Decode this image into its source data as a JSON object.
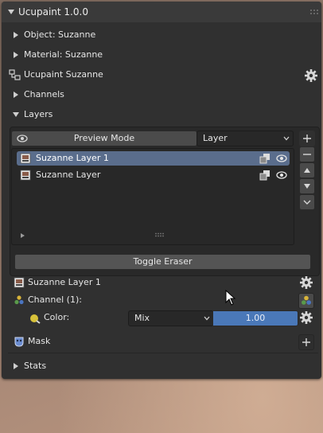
{
  "panel": {
    "title": "Ucupaint 1.0.0",
    "sections": {
      "object": "Object: Suzanne",
      "material": "Material: Suzanne",
      "ucupaint_node": "Ucupaint Suzanne",
      "channels": "Channels",
      "layers": "Layers",
      "stats": "Stats"
    }
  },
  "layers": {
    "preview_mode_label": "Preview Mode",
    "preview_dropdown_value": "Layer",
    "items": [
      {
        "name": "Suzanne Layer 1",
        "selected": true
      },
      {
        "name": "Suzanne Layer",
        "selected": false
      }
    ],
    "toggle_eraser_label": "Toggle Eraser"
  },
  "active_layer": {
    "name": "Suzanne Layer 1",
    "channel_label": "Channel (1):",
    "color_label": "Color:",
    "blend_mode": "Mix",
    "intensity": "1.00",
    "mask_label": "Mask"
  },
  "colors": {
    "panel_bg": "#303030",
    "selected_row": "#5a6d8c",
    "slider_blue": "#4a78b8"
  }
}
